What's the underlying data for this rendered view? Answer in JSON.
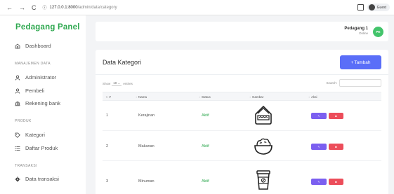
{
  "browser": {
    "back": "←",
    "forward": "→",
    "reload": "C",
    "info": "ⓘ",
    "url_host": "127.0.0.1:8000",
    "url_path": "/admin/data/category",
    "profile": "Guest"
  },
  "sidebar": {
    "brand": "Pedagang Panel",
    "dashboard": "Dashboard",
    "sections": {
      "manajemen": "MANAJEMEN DATA",
      "produk": "PRODUK",
      "transaksi": "TRANSAKSI"
    },
    "items": {
      "administrator": "Administrator",
      "pembeli": "Pembeli",
      "rekening": "Rekening bank",
      "kategori": "Kategori",
      "daftar_produk": "Daftar Produk",
      "data_transaksi": "Data transaksi"
    }
  },
  "topbar": {
    "user_name": "Pedagang 1",
    "user_status": "Online",
    "avatar": "PE"
  },
  "card": {
    "title": "Data Kategori",
    "add_button": "Tambah",
    "show_label": "Show",
    "show_value": "10",
    "entries_label": "entries",
    "search_label": "Search:"
  },
  "table": {
    "headers": {
      "no": "#",
      "name": "Nama",
      "status": "Status",
      "image": "Gambar",
      "action": "Aksi"
    },
    "rows": [
      {
        "no": "1",
        "name": "Kerajinan",
        "status": "Aktif",
        "icon": "craft-basket-icon"
      },
      {
        "no": "2",
        "name": "Makanan",
        "status": "Aktif",
        "icon": "food-bowl-icon"
      },
      {
        "no": "3",
        "name": "Minuman",
        "status": "Aktif",
        "icon": "drink-cup-icon"
      }
    ]
  },
  "colors": {
    "brand": "#2ea84f",
    "primary": "#5a6ef8",
    "edit": "#7b5ff0",
    "delete": "#ec4d5a",
    "active": "#2ea84f"
  }
}
